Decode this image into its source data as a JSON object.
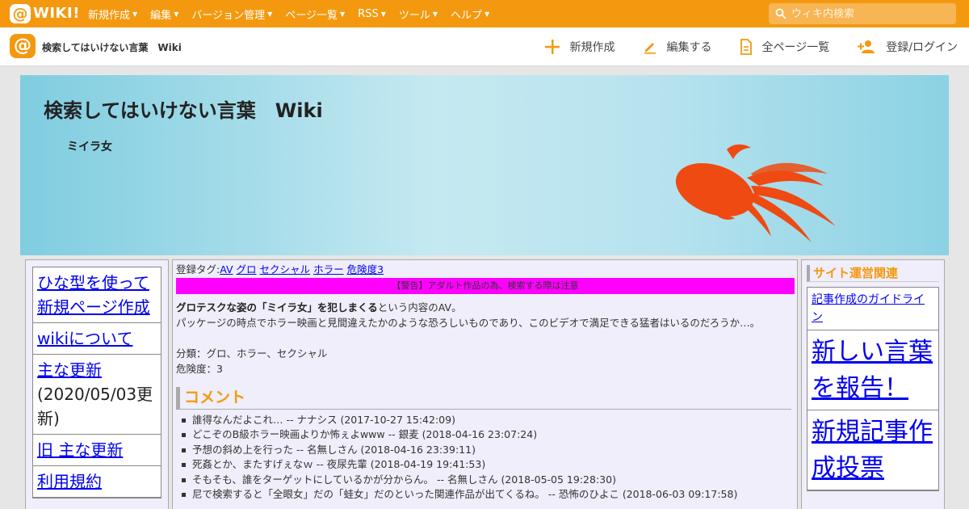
{
  "topbar": {
    "logo_text": "WIKI!",
    "menu": [
      "新規作成",
      "編集",
      "バージョン管理",
      "ページ一覧",
      "RSS",
      "ツール",
      "ヘルプ"
    ],
    "search_placeholder": "ウィキ内検索"
  },
  "subbar": {
    "title": "検索してはいけない言葉　Wiki",
    "actions": [
      "新規作成",
      "編集する",
      "全ページ一覧",
      "登録/ログイン"
    ]
  },
  "banner": {
    "title": "検索してはいけない言葉　Wiki",
    "subtitle": "ミイラ女"
  },
  "left_nav": [
    {
      "link": "ひな型を使って新規ページ作成",
      "note": ""
    },
    {
      "link": "wikiについて",
      "note": ""
    },
    {
      "link": "主な更新",
      "note": "(2020/05/03更新)"
    },
    {
      "link": "旧 主な更新",
      "note": ""
    },
    {
      "link": "利用規約",
      "note": ""
    }
  ],
  "content": {
    "tags_label": "登録タグ:",
    "tags": [
      "AV",
      "グロ",
      "セクシャル",
      "ホラー",
      "危険度3"
    ],
    "warning": "【警告】アダルト作品の為、検索する際は注意",
    "intro_bold": "グロテスクな姿の「ミイラ女」を犯しまくる",
    "intro_rest": "という内容のAV。",
    "line2": "パッケージの時点でホラー映画と見間違えたかのような恐ろしいものであり、このビデオで満足できる猛者はいるのだろうか…。",
    "category": "分類：グロ、ホラー、セクシャル",
    "danger": "危険度：3",
    "comment_heading": "コメント",
    "comments": [
      "誰得なんだよこれ… -- ナナシス (2017-10-27 15:42:09)",
      "どこぞのB級ホラー映画よりか怖ぇよwww -- 銀麦 (2018-04-16 23:07:24)",
      "予想の斜め上を行った -- 名無しさん (2018-04-16 23:39:11)",
      "死姦とか、またすげぇなｗ -- 夜尿先輩 (2018-04-19 19:41:53)",
      "そもそも、誰をターゲットにしているかが分からん。 -- 名無しさん (2018-05-05 19:28:30)",
      "尼で検索すると「全眼女」だの「蛙女」だのといった関連作品が出てくるね。 -- 恐怖のひよこ (2018-06-03 09:17:58)"
    ]
  },
  "right_nav": {
    "heading": "サイト運営関連",
    "items": [
      {
        "label": "記事作成のガイドライン",
        "size": "small"
      },
      {
        "label": "新しい言葉を報告！",
        "size": "big"
      },
      {
        "label": "新規記事作成投票",
        "size": "big"
      }
    ]
  },
  "colors": {
    "brand": "#f4990f",
    "warning_bg": "#ff00ff",
    "link": "#0000ee",
    "fish": "#ee4a12"
  }
}
